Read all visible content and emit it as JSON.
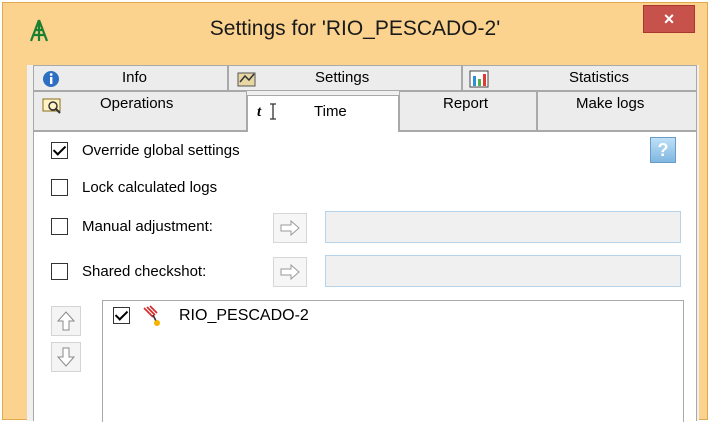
{
  "window": {
    "title": "Settings for 'RIO_PESCADO-2'",
    "close_label": "×",
    "app_icon": "rig-icon",
    "colors": {
      "title_bar": "#fbd38f",
      "close": "#c7514b",
      "panel": "#ffffff"
    }
  },
  "tabs": {
    "row1": [
      {
        "label": "Info",
        "icon": "info-icon"
      },
      {
        "label": "Settings",
        "icon": "settings-icon"
      },
      {
        "label": "Statistics",
        "icon": "statistics-icon"
      }
    ],
    "row2": [
      {
        "label": "Operations",
        "icon": "operations-icon"
      },
      {
        "label": "Time",
        "icon": "time-icon",
        "active": true
      },
      {
        "label": "Report"
      },
      {
        "label": "Make logs"
      }
    ]
  },
  "time_tab": {
    "override_global": {
      "label": "Override global settings",
      "checked": true
    },
    "lock_calculated": {
      "label": "Lock calculated logs",
      "checked": false
    },
    "manual_adjustment": {
      "label": "Manual adjustment:",
      "checked": false,
      "value": ""
    },
    "shared_checkshot": {
      "label": "Shared checkshot:",
      "checked": false,
      "value": ""
    },
    "help_label": "?",
    "wells": [
      {
        "name": "RIO_PESCADO-2",
        "checked": true,
        "icon": "well-icon"
      }
    ]
  }
}
